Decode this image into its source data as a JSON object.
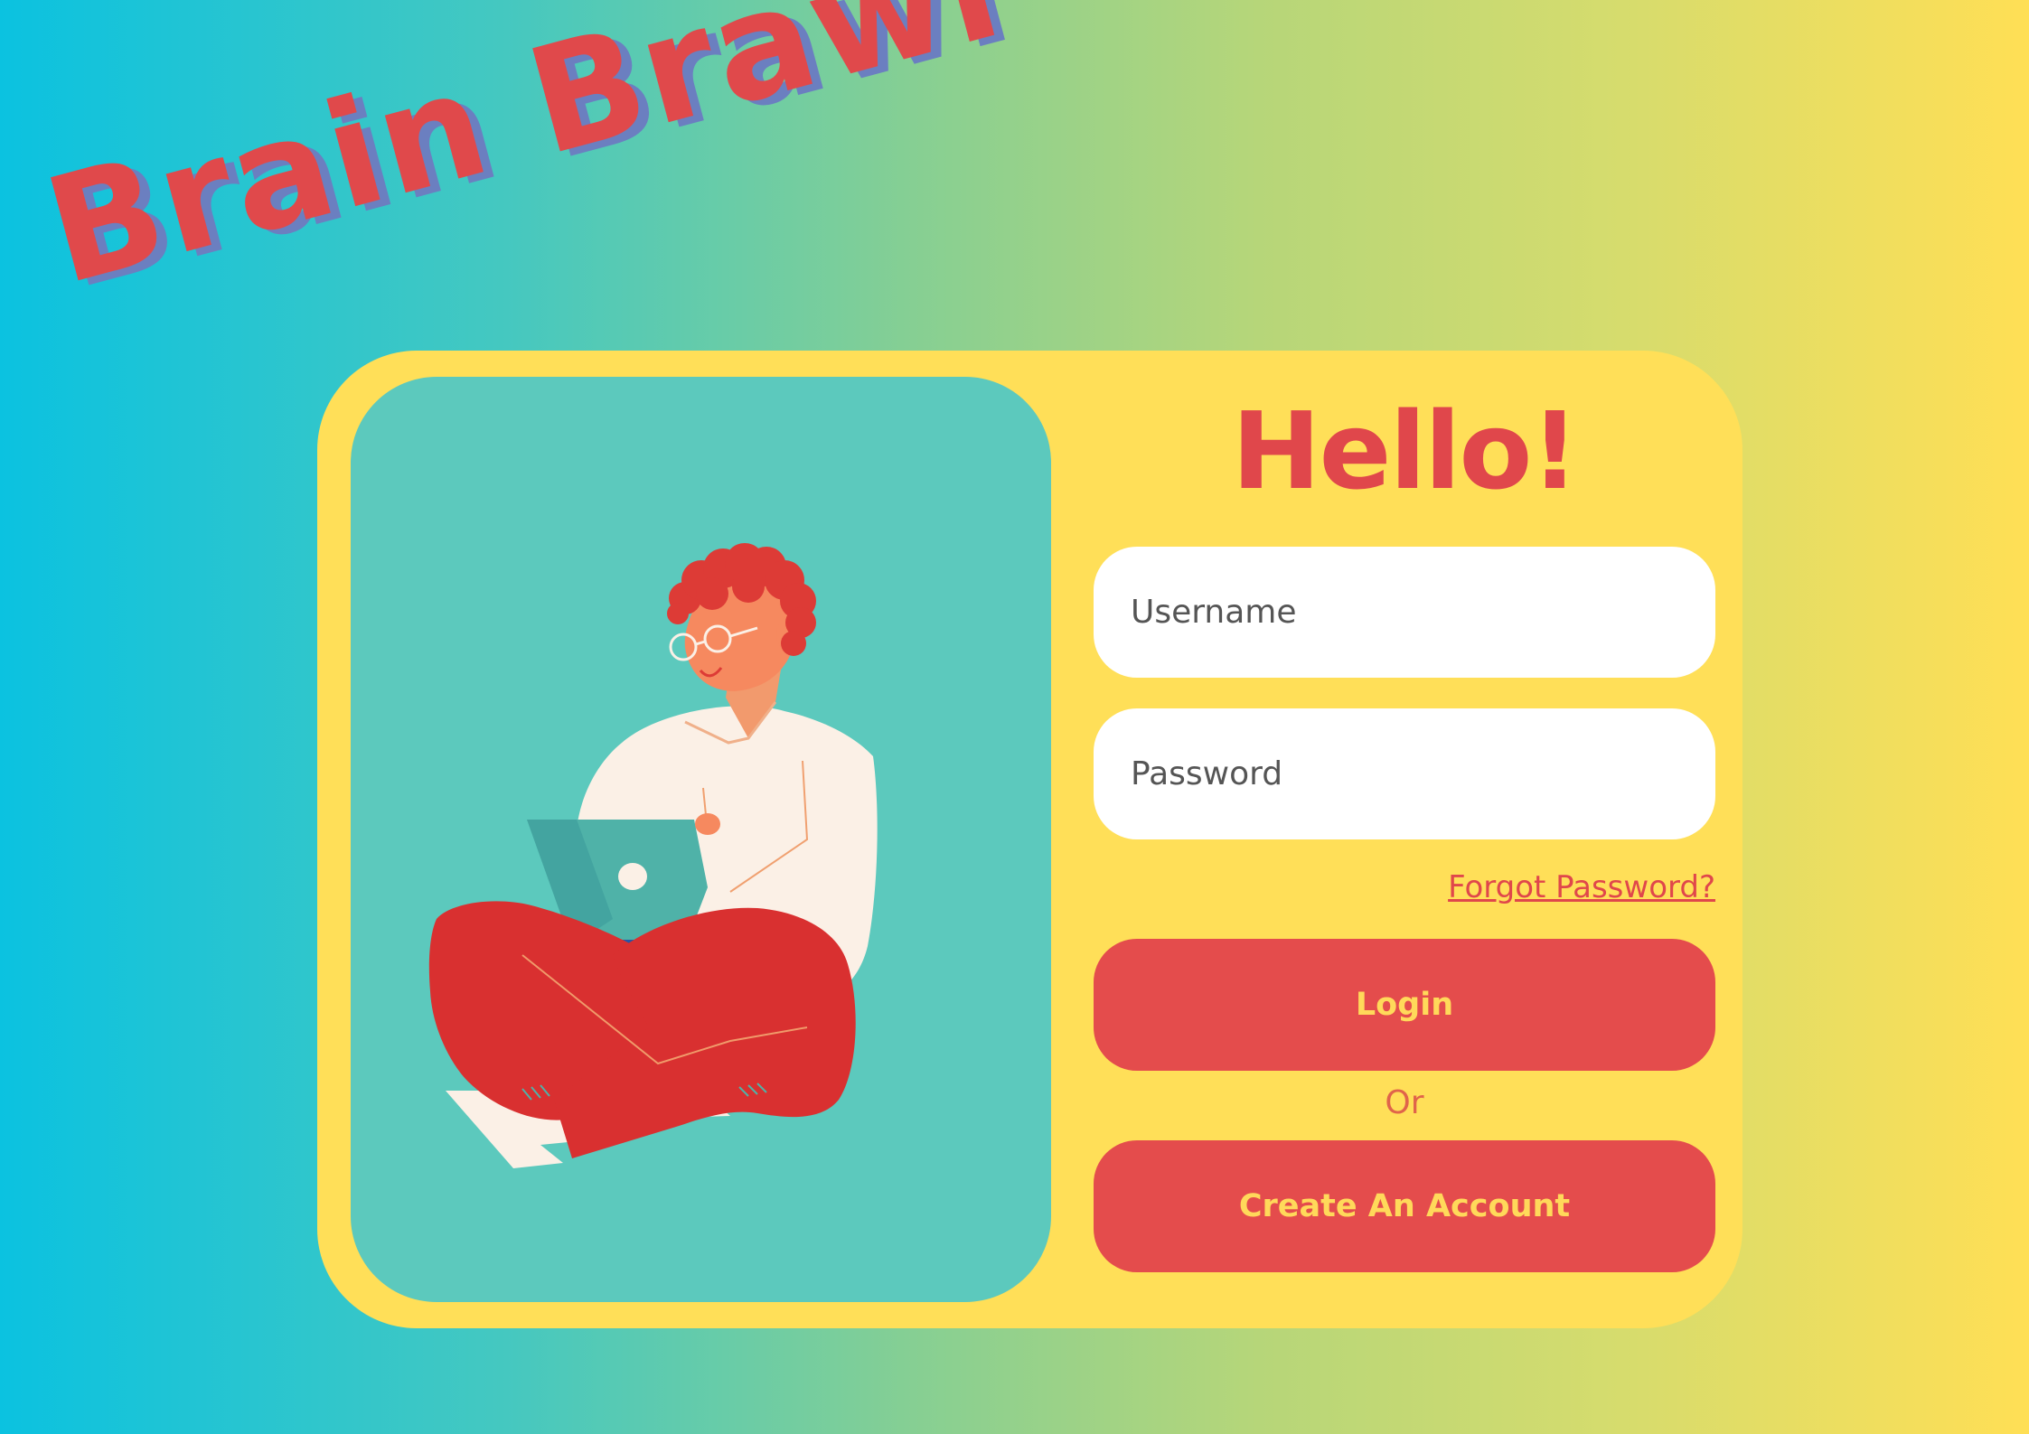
{
  "logo": {
    "text": "Brain Brawl"
  },
  "greeting": "Hello!",
  "form": {
    "username_placeholder": "Username",
    "password_placeholder": "Password",
    "forgot_password": "Forgot Password?",
    "login_label": "Login",
    "or_label": "Or",
    "create_account_label": "Create An Account"
  },
  "colors": {
    "accent_red": "#e44c4c",
    "card_yellow": "#ffdf58",
    "panel_teal": "#5cc9bd",
    "button_text": "#ffd95a"
  },
  "illustration": {
    "subject": "person-sitting-with-laptop"
  }
}
